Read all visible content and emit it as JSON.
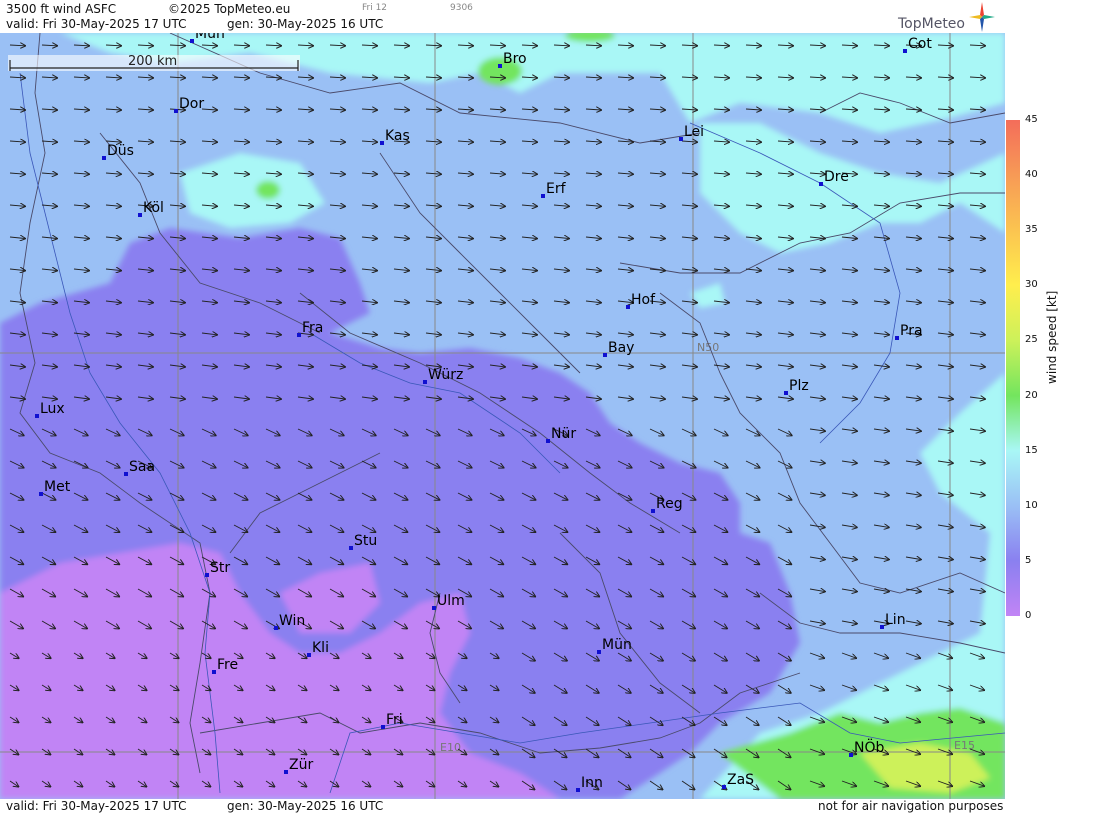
{
  "header": {
    "product": "3500 ft wind ASFC",
    "copyright": "©2025 TopMeteo.eu",
    "small1": "Fri 12",
    "small2": "9306",
    "valid_line": "valid:  Fri  30-May-2025  17 UTC",
    "gen_line": "gen:  30-May-2025 16 UTC",
    "brand": "TopMeteo"
  },
  "footer": {
    "valid_line": "valid:  Fri  30-May-2025  17 UTC",
    "gen_line": "gen:  30-May-2025 16 UTC",
    "disclaimer": "not for air navigation purposes"
  },
  "scale_bar": {
    "label": "200 km"
  },
  "grid_labels": {
    "n50": "N50",
    "e10": "E10",
    "e15": "E15"
  },
  "cities": [
    {
      "name": "Mün",
      "id": "mun-top"
    },
    {
      "name": "Bro"
    },
    {
      "name": "Cot"
    },
    {
      "name": "Dor"
    },
    {
      "name": "Kas"
    },
    {
      "name": "Lei"
    },
    {
      "name": "Düs"
    },
    {
      "name": "Erf"
    },
    {
      "name": "Dre"
    },
    {
      "name": "Köl"
    },
    {
      "name": "Hof"
    },
    {
      "name": "Fra"
    },
    {
      "name": "Pra"
    },
    {
      "name": "Bay"
    },
    {
      "name": "Würz"
    },
    {
      "name": "Plz"
    },
    {
      "name": "Lux"
    },
    {
      "name": "Nür"
    },
    {
      "name": "Saa"
    },
    {
      "name": "Met"
    },
    {
      "name": "Reg"
    },
    {
      "name": "Stu"
    },
    {
      "name": "Str"
    },
    {
      "name": "Ulm"
    },
    {
      "name": "Win"
    },
    {
      "name": "Lin"
    },
    {
      "name": "Kli"
    },
    {
      "name": "Mün"
    },
    {
      "name": "Fre"
    },
    {
      "name": "Fri"
    },
    {
      "name": "NÖb"
    },
    {
      "name": "Zür"
    },
    {
      "name": "ZaS"
    },
    {
      "name": "Inn"
    }
  ],
  "legend": {
    "title": "wind speed [kt]",
    "ticks": [
      "45",
      "40",
      "35",
      "30",
      "25",
      "20",
      "15",
      "10",
      "5",
      "0"
    ],
    "colors": [
      "#f46d5a",
      "#f79a56",
      "#fbc450",
      "#ffee4d",
      "#cdf15a",
      "#73e55e",
      "#a9f7f6",
      "#9ac0f5",
      "#8a80f0",
      "#c184f5"
    ]
  },
  "field_colors": {
    "calm": "#c184f5",
    "light": "#8a80f0",
    "moderate": "#9ac0f5",
    "fresh": "#a9f7f6",
    "strong": "#73e55e",
    "stronger": "#cdf15a"
  }
}
